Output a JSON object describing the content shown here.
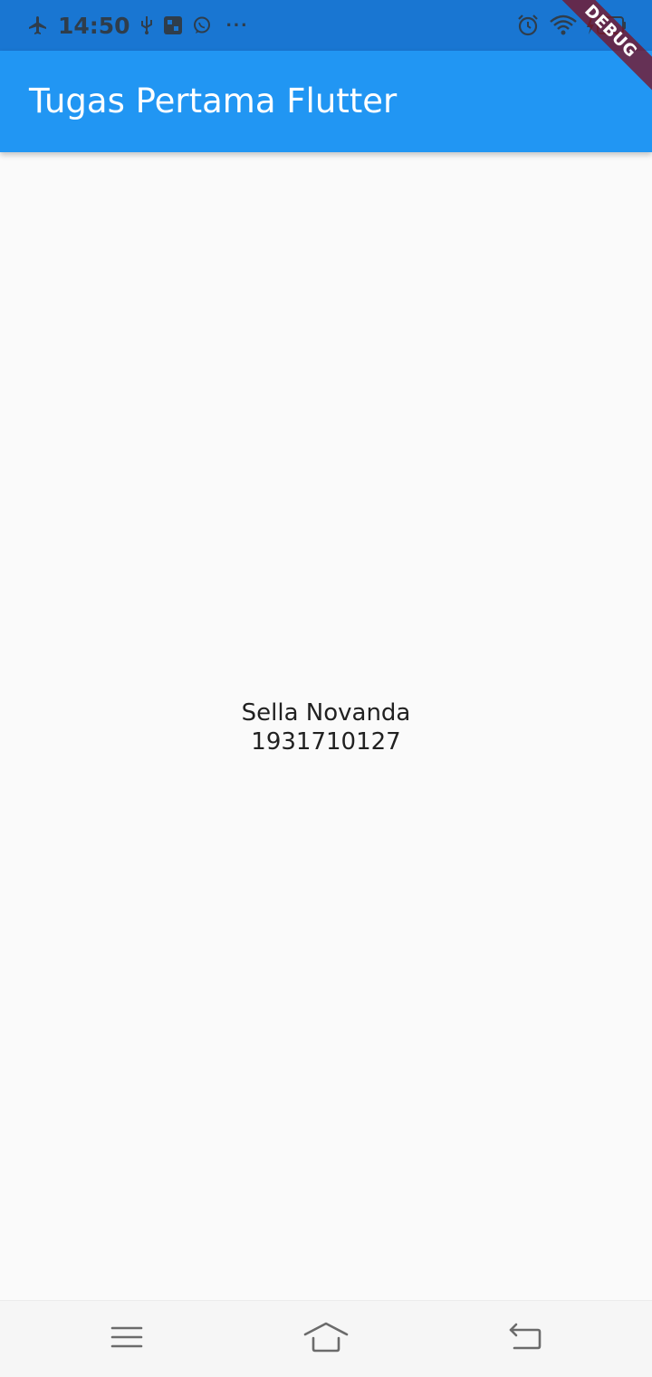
{
  "status_bar": {
    "time": "14:50",
    "more": "···",
    "left_icons": [
      "airplane-icon",
      "usb-icon",
      "notification-app-icon",
      "whatsapp-icon"
    ],
    "right_icons": [
      "alarm-icon",
      "wifi-icon",
      "battery-icon"
    ],
    "color": "#1976d2"
  },
  "app_bar": {
    "title": "Tugas Pertama Flutter",
    "color": "#2196f3"
  },
  "debug_banner": {
    "label": "DEBUG"
  },
  "content": {
    "name": "Sella Novanda",
    "id_number": "1931710127"
  },
  "nav_bar": {
    "buttons": [
      "menu-icon",
      "home-icon",
      "back-icon"
    ]
  }
}
